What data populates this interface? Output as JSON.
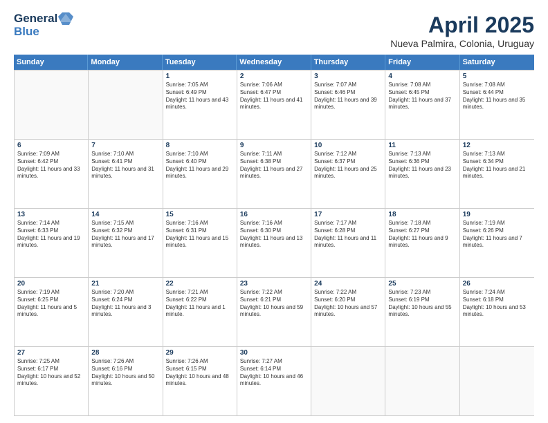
{
  "header": {
    "logo_general": "General",
    "logo_blue": "Blue",
    "title": "April 2025",
    "location": "Nueva Palmira, Colonia, Uruguay"
  },
  "weekdays": [
    "Sunday",
    "Monday",
    "Tuesday",
    "Wednesday",
    "Thursday",
    "Friday",
    "Saturday"
  ],
  "rows": [
    [
      {
        "day": "",
        "sunrise": "",
        "sunset": "",
        "daylight": ""
      },
      {
        "day": "",
        "sunrise": "",
        "sunset": "",
        "daylight": ""
      },
      {
        "day": "1",
        "sunrise": "Sunrise: 7:05 AM",
        "sunset": "Sunset: 6:49 PM",
        "daylight": "Daylight: 11 hours and 43 minutes."
      },
      {
        "day": "2",
        "sunrise": "Sunrise: 7:06 AM",
        "sunset": "Sunset: 6:47 PM",
        "daylight": "Daylight: 11 hours and 41 minutes."
      },
      {
        "day": "3",
        "sunrise": "Sunrise: 7:07 AM",
        "sunset": "Sunset: 6:46 PM",
        "daylight": "Daylight: 11 hours and 39 minutes."
      },
      {
        "day": "4",
        "sunrise": "Sunrise: 7:08 AM",
        "sunset": "Sunset: 6:45 PM",
        "daylight": "Daylight: 11 hours and 37 minutes."
      },
      {
        "day": "5",
        "sunrise": "Sunrise: 7:08 AM",
        "sunset": "Sunset: 6:44 PM",
        "daylight": "Daylight: 11 hours and 35 minutes."
      }
    ],
    [
      {
        "day": "6",
        "sunrise": "Sunrise: 7:09 AM",
        "sunset": "Sunset: 6:42 PM",
        "daylight": "Daylight: 11 hours and 33 minutes."
      },
      {
        "day": "7",
        "sunrise": "Sunrise: 7:10 AM",
        "sunset": "Sunset: 6:41 PM",
        "daylight": "Daylight: 11 hours and 31 minutes."
      },
      {
        "day": "8",
        "sunrise": "Sunrise: 7:10 AM",
        "sunset": "Sunset: 6:40 PM",
        "daylight": "Daylight: 11 hours and 29 minutes."
      },
      {
        "day": "9",
        "sunrise": "Sunrise: 7:11 AM",
        "sunset": "Sunset: 6:38 PM",
        "daylight": "Daylight: 11 hours and 27 minutes."
      },
      {
        "day": "10",
        "sunrise": "Sunrise: 7:12 AM",
        "sunset": "Sunset: 6:37 PM",
        "daylight": "Daylight: 11 hours and 25 minutes."
      },
      {
        "day": "11",
        "sunrise": "Sunrise: 7:13 AM",
        "sunset": "Sunset: 6:36 PM",
        "daylight": "Daylight: 11 hours and 23 minutes."
      },
      {
        "day": "12",
        "sunrise": "Sunrise: 7:13 AM",
        "sunset": "Sunset: 6:34 PM",
        "daylight": "Daylight: 11 hours and 21 minutes."
      }
    ],
    [
      {
        "day": "13",
        "sunrise": "Sunrise: 7:14 AM",
        "sunset": "Sunset: 6:33 PM",
        "daylight": "Daylight: 11 hours and 19 minutes."
      },
      {
        "day": "14",
        "sunrise": "Sunrise: 7:15 AM",
        "sunset": "Sunset: 6:32 PM",
        "daylight": "Daylight: 11 hours and 17 minutes."
      },
      {
        "day": "15",
        "sunrise": "Sunrise: 7:16 AM",
        "sunset": "Sunset: 6:31 PM",
        "daylight": "Daylight: 11 hours and 15 minutes."
      },
      {
        "day": "16",
        "sunrise": "Sunrise: 7:16 AM",
        "sunset": "Sunset: 6:30 PM",
        "daylight": "Daylight: 11 hours and 13 minutes."
      },
      {
        "day": "17",
        "sunrise": "Sunrise: 7:17 AM",
        "sunset": "Sunset: 6:28 PM",
        "daylight": "Daylight: 11 hours and 11 minutes."
      },
      {
        "day": "18",
        "sunrise": "Sunrise: 7:18 AM",
        "sunset": "Sunset: 6:27 PM",
        "daylight": "Daylight: 11 hours and 9 minutes."
      },
      {
        "day": "19",
        "sunrise": "Sunrise: 7:19 AM",
        "sunset": "Sunset: 6:26 PM",
        "daylight": "Daylight: 11 hours and 7 minutes."
      }
    ],
    [
      {
        "day": "20",
        "sunrise": "Sunrise: 7:19 AM",
        "sunset": "Sunset: 6:25 PM",
        "daylight": "Daylight: 11 hours and 5 minutes."
      },
      {
        "day": "21",
        "sunrise": "Sunrise: 7:20 AM",
        "sunset": "Sunset: 6:24 PM",
        "daylight": "Daylight: 11 hours and 3 minutes."
      },
      {
        "day": "22",
        "sunrise": "Sunrise: 7:21 AM",
        "sunset": "Sunset: 6:22 PM",
        "daylight": "Daylight: 11 hours and 1 minute."
      },
      {
        "day": "23",
        "sunrise": "Sunrise: 7:22 AM",
        "sunset": "Sunset: 6:21 PM",
        "daylight": "Daylight: 10 hours and 59 minutes."
      },
      {
        "day": "24",
        "sunrise": "Sunrise: 7:22 AM",
        "sunset": "Sunset: 6:20 PM",
        "daylight": "Daylight: 10 hours and 57 minutes."
      },
      {
        "day": "25",
        "sunrise": "Sunrise: 7:23 AM",
        "sunset": "Sunset: 6:19 PM",
        "daylight": "Daylight: 10 hours and 55 minutes."
      },
      {
        "day": "26",
        "sunrise": "Sunrise: 7:24 AM",
        "sunset": "Sunset: 6:18 PM",
        "daylight": "Daylight: 10 hours and 53 minutes."
      }
    ],
    [
      {
        "day": "27",
        "sunrise": "Sunrise: 7:25 AM",
        "sunset": "Sunset: 6:17 PM",
        "daylight": "Daylight: 10 hours and 52 minutes."
      },
      {
        "day": "28",
        "sunrise": "Sunrise: 7:26 AM",
        "sunset": "Sunset: 6:16 PM",
        "daylight": "Daylight: 10 hours and 50 minutes."
      },
      {
        "day": "29",
        "sunrise": "Sunrise: 7:26 AM",
        "sunset": "Sunset: 6:15 PM",
        "daylight": "Daylight: 10 hours and 48 minutes."
      },
      {
        "day": "30",
        "sunrise": "Sunrise: 7:27 AM",
        "sunset": "Sunset: 6:14 PM",
        "daylight": "Daylight: 10 hours and 46 minutes."
      },
      {
        "day": "",
        "sunrise": "",
        "sunset": "",
        "daylight": ""
      },
      {
        "day": "",
        "sunrise": "",
        "sunset": "",
        "daylight": ""
      },
      {
        "day": "",
        "sunrise": "",
        "sunset": "",
        "daylight": ""
      }
    ]
  ]
}
